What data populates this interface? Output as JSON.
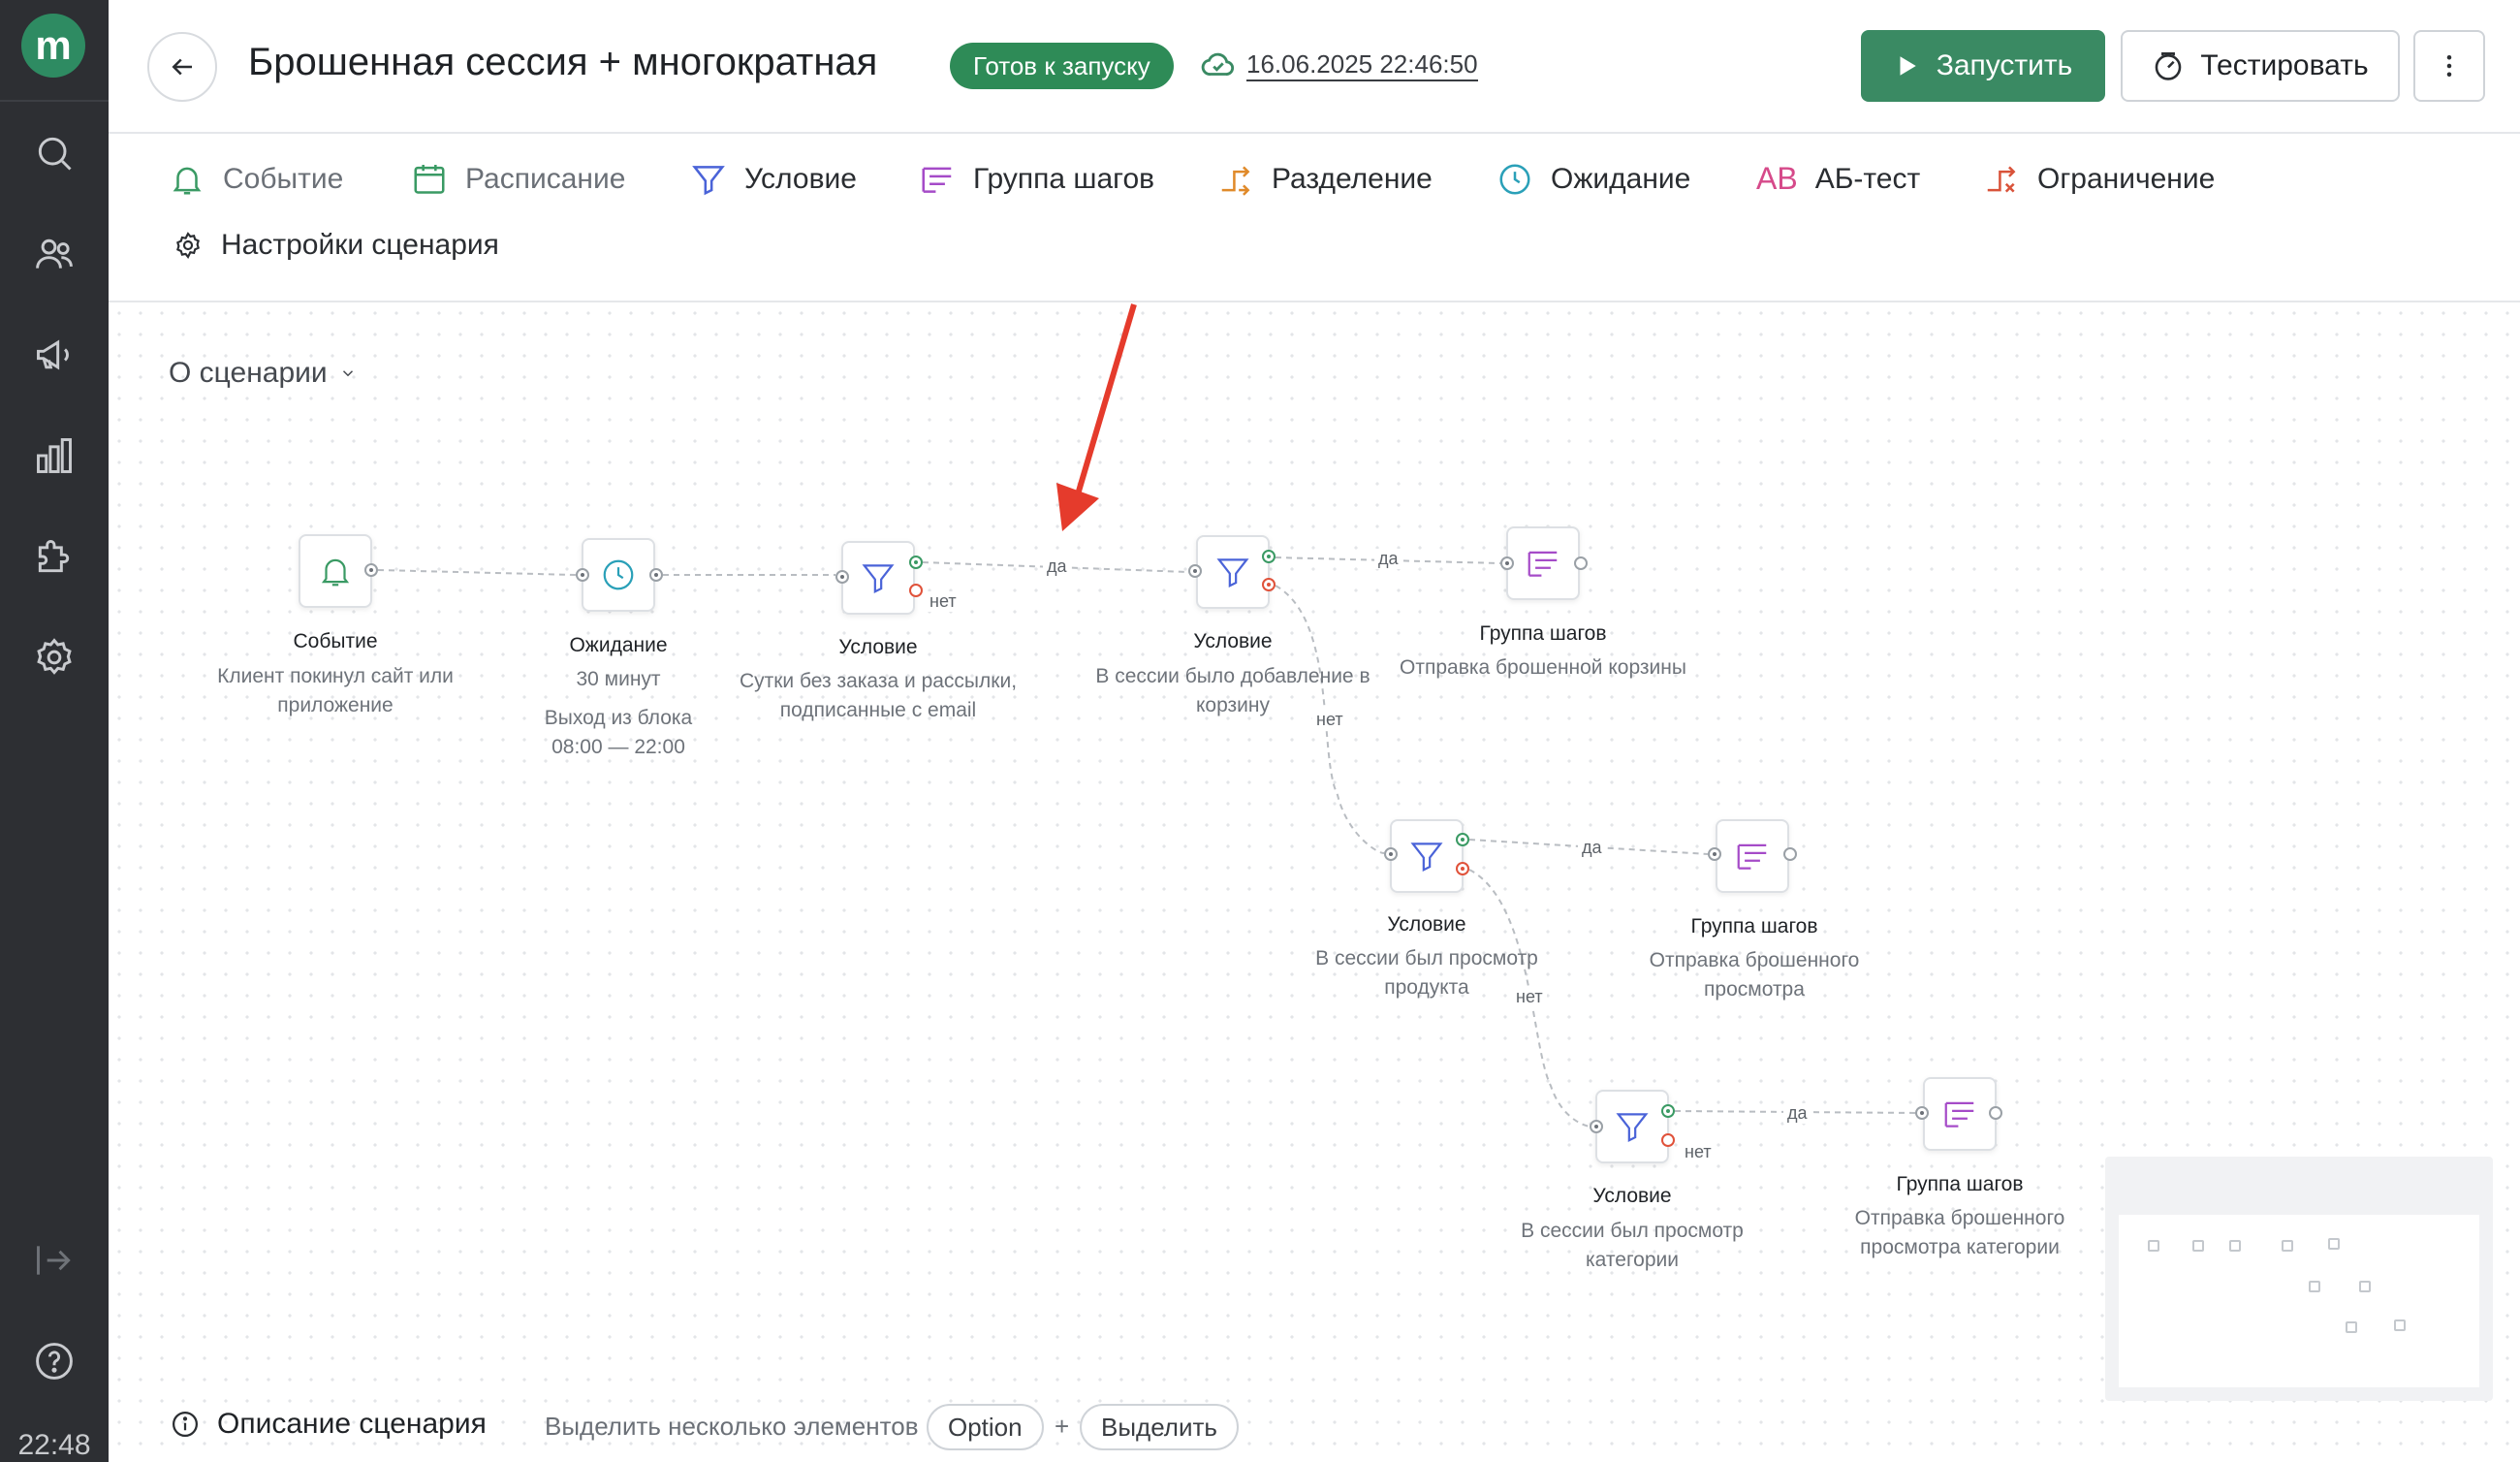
{
  "sidebar": {
    "logo": "m",
    "items": [
      {
        "name": "search-icon"
      },
      {
        "name": "users-icon"
      },
      {
        "name": "megaphone-icon"
      },
      {
        "name": "chart-icon"
      },
      {
        "name": "puzzle-icon"
      },
      {
        "name": "settings-icon"
      },
      {
        "name": "collapse-icon"
      },
      {
        "name": "help-icon"
      }
    ],
    "clock": "22:48"
  },
  "header": {
    "title": "Брошенная сессия + многократная",
    "status": "Готов к запуску",
    "saved_at": "16.06.2025 22:46:50",
    "run_label": "Запустить",
    "test_label": "Тестировать"
  },
  "toolbar": {
    "items": [
      {
        "label": "Событие",
        "icon": "bell-icon"
      },
      {
        "label": "Расписание",
        "icon": "calendar-icon"
      },
      {
        "label": "Условие",
        "icon": "funnel-icon"
      },
      {
        "label": "Группа шагов",
        "icon": "step-group-icon"
      },
      {
        "label": "Разделение",
        "icon": "split-icon"
      },
      {
        "label": "Ожидание",
        "icon": "clock-icon"
      },
      {
        "label": "АБ-тест",
        "icon": "ab-icon"
      },
      {
        "label": "Ограничение",
        "icon": "limit-icon"
      }
    ],
    "settings_label": "Настройки сценария"
  },
  "canvas": {
    "about_label": "О сценарии",
    "nodes": [
      {
        "id": "event",
        "title": "Событие",
        "desc": [
          "Клиент покинул сайт или",
          "приложение"
        ]
      },
      {
        "id": "wait",
        "title": "Ожидание",
        "desc": [
          "30 минут",
          "Выход из блока",
          "08:00 — 22:00"
        ]
      },
      {
        "id": "cond1",
        "title": "Условие",
        "desc": [
          "Сутки без заказа и рассылки,",
          "подписанные с email"
        ]
      },
      {
        "id": "cond2",
        "title": "Условие",
        "desc": [
          "В сессии было добавление в",
          "корзину"
        ]
      },
      {
        "id": "grp1",
        "title": "Группа шагов",
        "desc": [
          "Отправка брошенной корзины"
        ]
      },
      {
        "id": "cond3",
        "title": "Условие",
        "desc": [
          "В сессии был просмотр",
          "продукта"
        ]
      },
      {
        "id": "grp2",
        "title": "Группа шагов",
        "desc": [
          "Отправка брошенного",
          "просмотра"
        ]
      },
      {
        "id": "cond4",
        "title": "Условие",
        "desc": [
          "В сессии был просмотр",
          "категории"
        ]
      },
      {
        "id": "grp3",
        "title": "Группа шагов",
        "desc": [
          "Отправка брошенного",
          "просмотра категории"
        ]
      }
    ],
    "edge_labels": {
      "yes": "да",
      "no": "нет"
    }
  },
  "bottom": {
    "description_label": "Описание сценария",
    "hint": "Выделить несколько элементов",
    "key1": "Option",
    "plus": "+",
    "key2": "Выделить"
  },
  "colors": {
    "accent": "#2e8b57",
    "sidebar": "#2d2f33",
    "yes_port": "#3a9a64",
    "no_port": "#e0523a",
    "annotation_arrow": "#e53b2c"
  }
}
